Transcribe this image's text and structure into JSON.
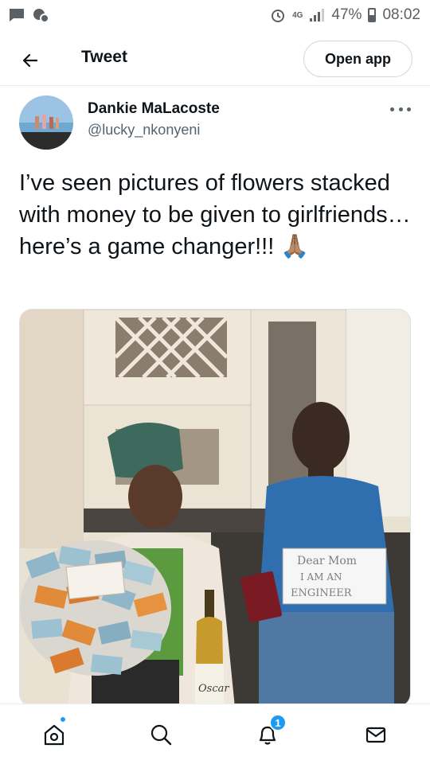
{
  "status_bar": {
    "network": "4G",
    "battery": "47%",
    "time": "08:02"
  },
  "header": {
    "title": "Tweet",
    "open_app_label": "Open app"
  },
  "author": {
    "name": "Dankie MaLacoste",
    "handle": "@lucky_nkonyeni"
  },
  "tweet": {
    "text": "I’ve seen pictures of flowers stacked with money to be given to girlfriends…here’s a game changer!!! 🙏🏽"
  },
  "media": {
    "sign_lines": [
      "Dear Mom",
      "I AM AN",
      "ENGINEER"
    ],
    "bottle_label": "Oscar"
  },
  "bottom_nav": {
    "notification_count": "1"
  },
  "colors": {
    "accent": "#1d9bf0",
    "text": "#0f1419",
    "secondary_text": "#536471",
    "divider": "#e6ecf0"
  }
}
